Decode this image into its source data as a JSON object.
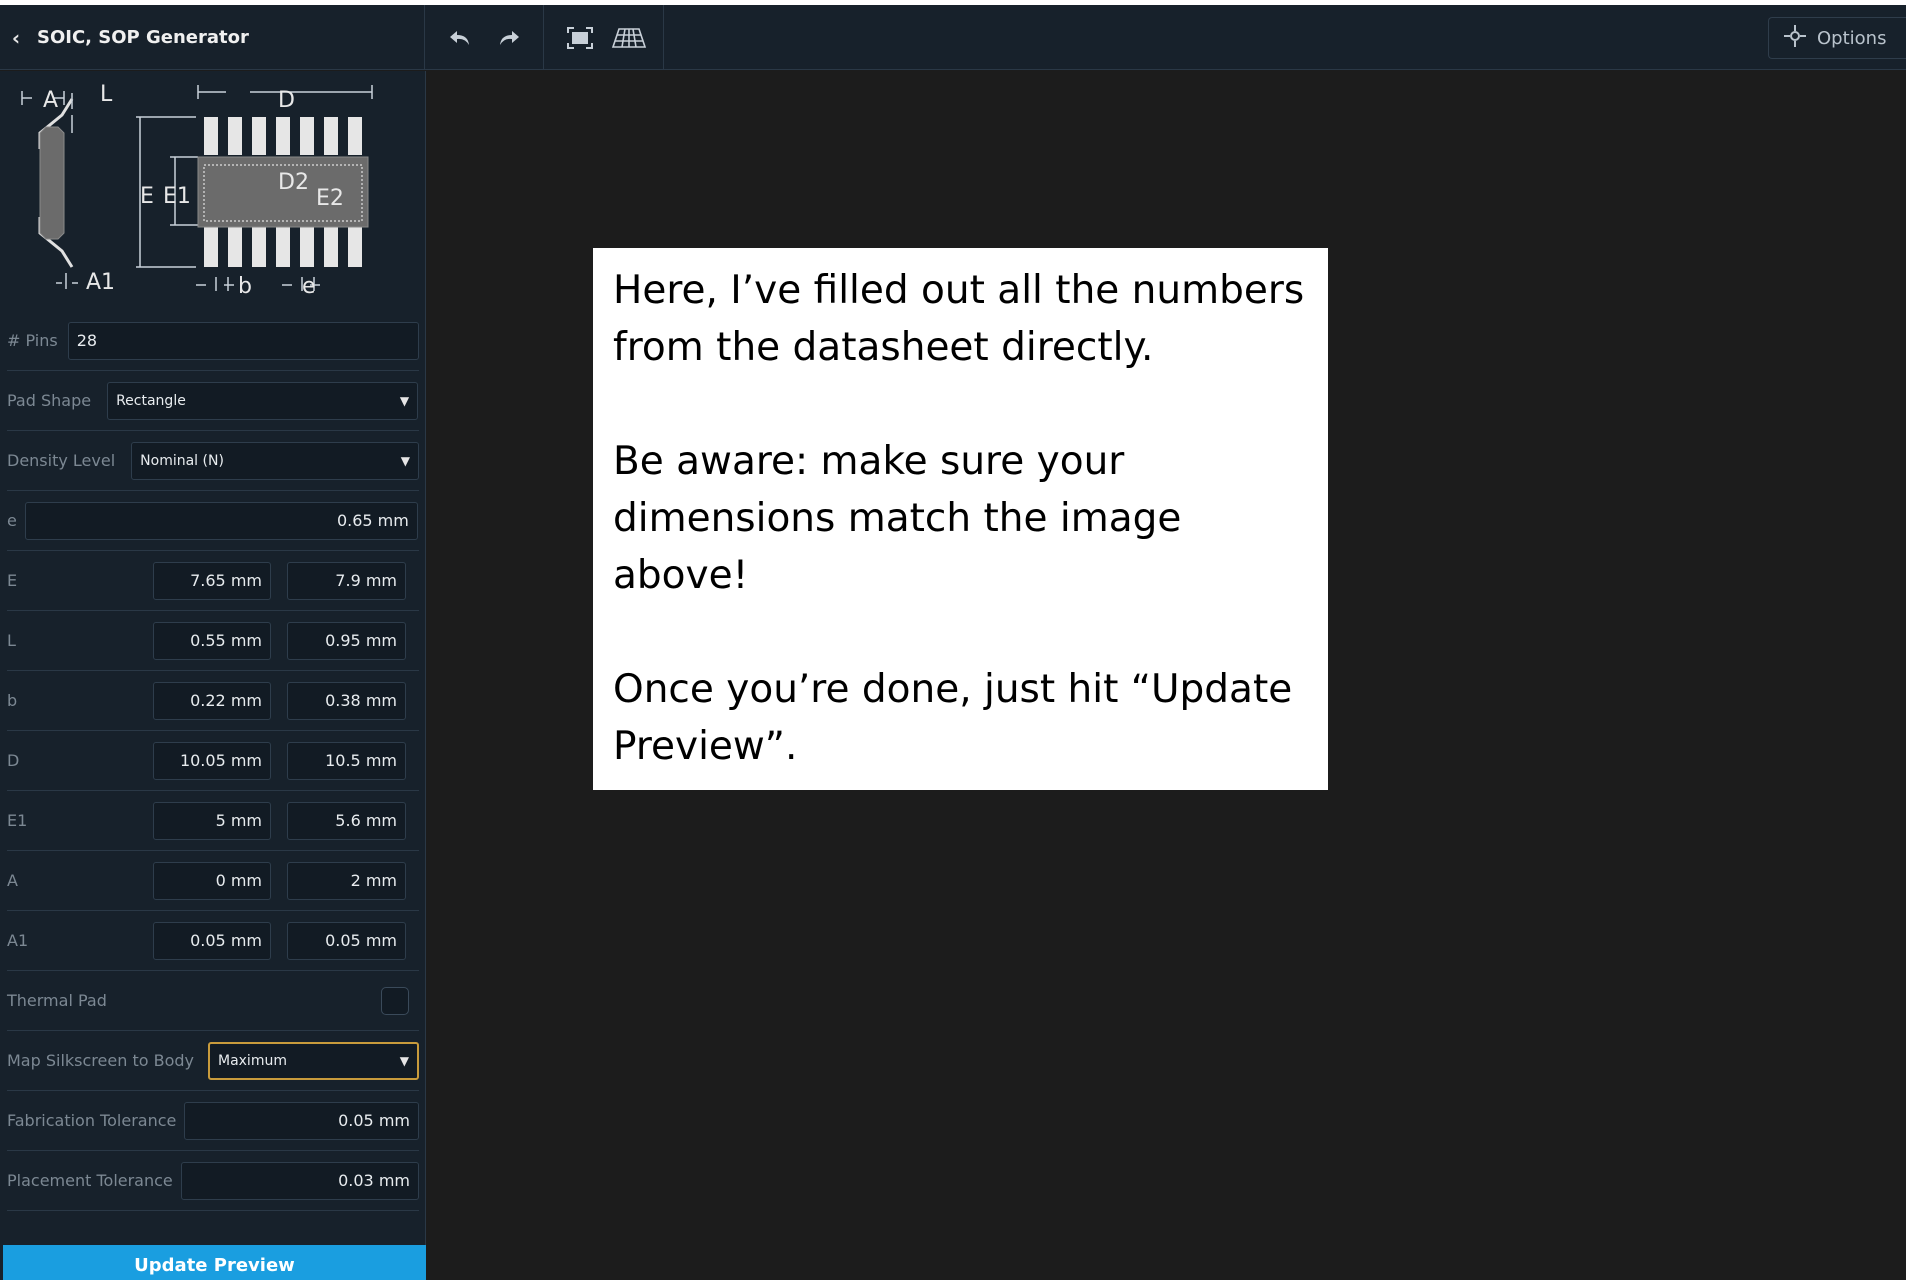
{
  "header": {
    "title": "SOIC, SOP Generator",
    "options_label": "Options"
  },
  "diagram_labels": {
    "A": "A",
    "L": "L",
    "D": "D",
    "E": "E",
    "E1": "E1",
    "D2": "D2",
    "E2": "E2",
    "A1": "A1",
    "b": "b",
    "e": "e"
  },
  "form": {
    "pins": {
      "label": "# Pins",
      "value": "28"
    },
    "pad_shape": {
      "label": "Pad Shape",
      "value": "Rectangle"
    },
    "density_level": {
      "label": "Density Level",
      "value": "Nominal (N)"
    },
    "e": {
      "label": "e",
      "value": "0.65 mm"
    },
    "E": {
      "label": "E",
      "min": "7.65 mm",
      "max": "7.9 mm"
    },
    "L": {
      "label": "L",
      "min": "0.55 mm",
      "max": "0.95 mm"
    },
    "b": {
      "label": "b",
      "min": "0.22 mm",
      "max": "0.38 mm"
    },
    "D": {
      "label": "D",
      "min": "10.05 mm",
      "max": "10.5 mm"
    },
    "E1": {
      "label": "E1",
      "min": "5 mm",
      "max": "5.6 mm"
    },
    "A": {
      "label": "A",
      "min": "0 mm",
      "max": "2 mm"
    },
    "A1": {
      "label": "A1",
      "min": "0.05 mm",
      "max": "0.05 mm"
    },
    "thermal_pad": {
      "label": "Thermal Pad",
      "checked": false
    },
    "map_silkscreen": {
      "label": "Map Silkscreen to Body",
      "value": "Maximum"
    },
    "fabrication_tolerance": {
      "label": "Fabrication Tolerance",
      "value": "0.05 mm"
    },
    "placement_tolerance": {
      "label": "Placement Tolerance",
      "value": "0.03 mm"
    }
  },
  "update_button_label": "Update Preview",
  "callout": {
    "p1": "Here, I’ve filled out all the numbers from the datasheet directly.",
    "p2": "Be aware: make sure your dimensions match the image above!",
    "p3": "Once you’re done, just hit “Update Preview”."
  },
  "colors": {
    "sidebar_bg": "#17212b",
    "canvas_bg": "#1c1c1c",
    "accent": "#1a9ee0",
    "active_border": "#c89b3c"
  }
}
